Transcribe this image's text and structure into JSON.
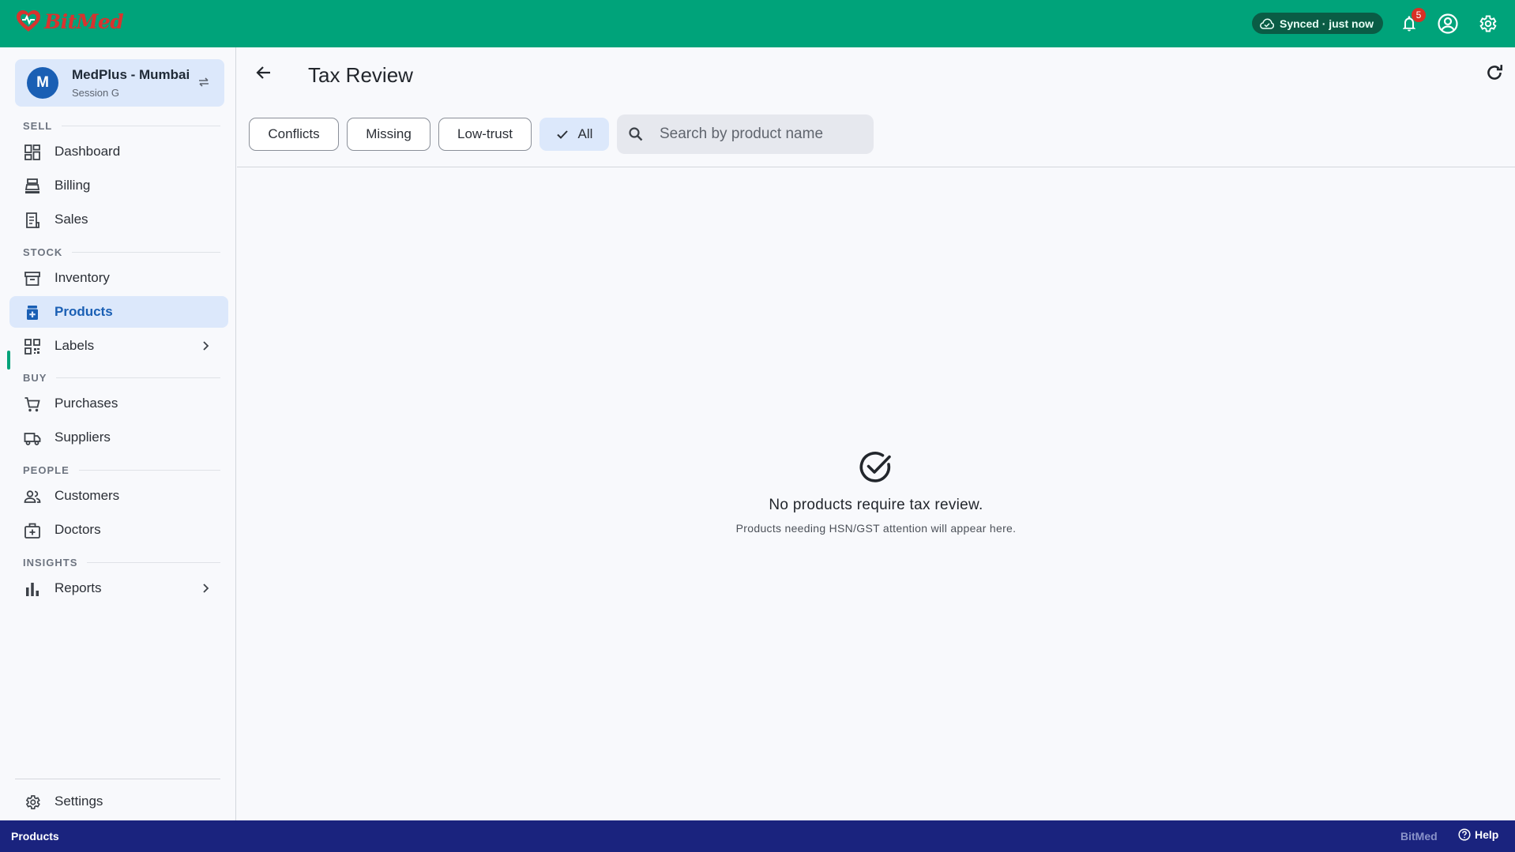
{
  "app": {
    "brand": "BitMed"
  },
  "topbar": {
    "sync_status": "Synced · just now",
    "notification_count": "5"
  },
  "store": {
    "avatar_letter": "M",
    "name": "MedPlus - Mumbai",
    "session": "Session G"
  },
  "sidebar": {
    "sections": {
      "sell": "SELL",
      "stock": "STOCK",
      "buy": "BUY",
      "people": "PEOPLE",
      "insights": "INSIGHTS"
    },
    "items": {
      "dashboard": "Dashboard",
      "billing": "Billing",
      "sales": "Sales",
      "inventory": "Inventory",
      "products": "Products",
      "labels": "Labels",
      "purchases": "Purchases",
      "suppliers": "Suppliers",
      "customers": "Customers",
      "doctors": "Doctors",
      "reports": "Reports",
      "settings": "Settings"
    },
    "active_item": "products"
  },
  "page": {
    "title": "Tax Review",
    "filters": [
      "Conflicts",
      "Missing",
      "Low-trust",
      "All"
    ],
    "selected_filter": "All",
    "search": {
      "placeholder": "Search by product name",
      "value": ""
    }
  },
  "empty_state": {
    "title": "No products require tax review.",
    "subtitle": "Products needing HSN/GST attention will appear here."
  },
  "footer": {
    "current_section": "Products",
    "brand": "BitMed",
    "help": "Help"
  },
  "colors": {
    "topbar": "#00a37a",
    "accent_blue": "#1a5fb4",
    "active_bg": "#dce8fb",
    "footer": "#1a237e",
    "logo_red": "#d8332f"
  }
}
